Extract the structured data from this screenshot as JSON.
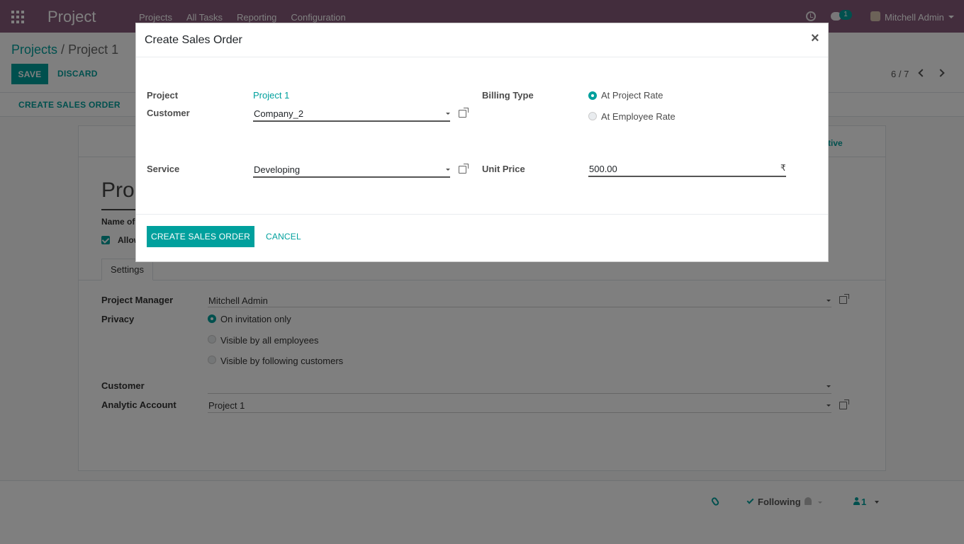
{
  "navbar": {
    "app_name": "Project",
    "menu": [
      "Projects",
      "All Tasks",
      "Reporting",
      "Configuration"
    ],
    "messages_badge": "1",
    "user_name": "Mitchell Admin",
    "color": "#875a7b"
  },
  "control_panel": {
    "breadcrumb_root": "Projects",
    "breadcrumb_separator": "/",
    "breadcrumb_current": "Project 1",
    "save_label": "SAVE",
    "discard_label": "DISCARD",
    "pager": "6 / 7",
    "status_button": "CREATE SALES ORDER"
  },
  "form": {
    "active_button": "tive",
    "title_partial": "Pro",
    "name_label_partial": "Name of",
    "allow_label_partial": "Allow",
    "tab_settings": "Settings",
    "project_manager_label": "Project Manager",
    "project_manager_value": "Mitchell Admin",
    "privacy_label": "Privacy",
    "privacy_options": [
      "On invitation only",
      "Visible by all employees",
      "Visible by following customers"
    ],
    "privacy_selected": "On invitation only",
    "customer_label": "Customer",
    "customer_value": "",
    "analytic_account_label": "Analytic Account",
    "analytic_account_value": "Project 1"
  },
  "chatter": {
    "following_label": "Following",
    "followers_count": "1"
  },
  "modal": {
    "title": "Create Sales Order",
    "close_symbol": "×",
    "project_label": "Project",
    "project_value": "Project 1",
    "customer_label": "Customer",
    "customer_value": "Company_2",
    "service_label": "Service",
    "service_value": "Developing",
    "billing_type_label": "Billing Type",
    "billing_options": [
      "At Project Rate",
      "At Employee Rate"
    ],
    "billing_selected": "At Project Rate",
    "unit_price_label": "Unit Price",
    "unit_price_value": "500.00",
    "currency_symbol": "₹",
    "create_button": "CREATE SALES ORDER",
    "cancel_button": "CANCEL",
    "accent_color": "#00a09d"
  }
}
